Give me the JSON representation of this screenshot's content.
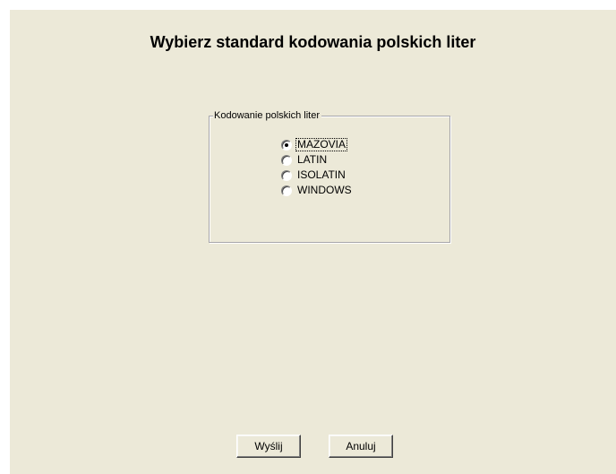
{
  "dialog": {
    "title": "Wybierz standard kodowania polskich liter"
  },
  "encoding_group": {
    "legend": "Kodowanie polskich liter",
    "selected": "MAZOVIA",
    "options": [
      {
        "label": "MAZOVIA",
        "checked": true
      },
      {
        "label": "LATIN",
        "checked": false
      },
      {
        "label": "ISOLATIN",
        "checked": false
      },
      {
        "label": "WINDOWS",
        "checked": false
      }
    ]
  },
  "buttons": {
    "send_label": "Wyślij",
    "cancel_label": "Anuluj"
  },
  "colors": {
    "dialog_background": "#ECE9D8",
    "page_background": "#FFFFFF"
  }
}
